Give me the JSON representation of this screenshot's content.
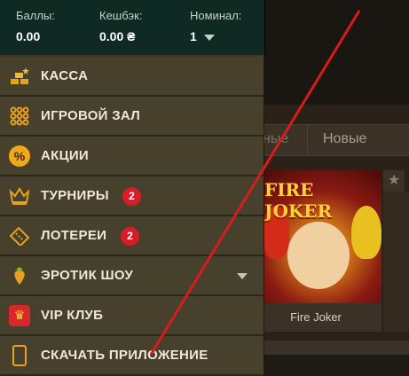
{
  "header": {
    "balance_label": "Баллы:",
    "balance_value": "0.00",
    "cashback_label": "Кешбэк:",
    "cashback_value": "0.00 ₴",
    "nominal_label": "Номинал:",
    "nominal_value": "1"
  },
  "menu": {
    "items": [
      {
        "label": "КАССА",
        "icon": "gold-bars-icon"
      },
      {
        "label": "ИГРОВОЙ ЗАЛ",
        "icon": "slot-grid-icon"
      },
      {
        "label": "АКЦИИ",
        "icon": "percent-icon"
      },
      {
        "label": "ТУРНИРЫ",
        "icon": "crown-icon",
        "badge": "2"
      },
      {
        "label": "ЛОТЕРЕИ",
        "icon": "ticket-icon",
        "badge": "2"
      },
      {
        "label": "ЭРОТИК ШОУ",
        "icon": "strawberry-icon"
      },
      {
        "label": "VIP КЛУБ",
        "icon": "vip-crown-icon"
      },
      {
        "label": "СКАЧАТЬ ПРИЛОЖЕНИЕ",
        "icon": "phone-icon"
      }
    ]
  },
  "tabs": {
    "tab1": "ные",
    "tab2": "Новые"
  },
  "game_card": {
    "art_title": "FIRE JOKER",
    "label": "Fire Joker"
  },
  "star_icon": "★",
  "colors": {
    "header_bg": "#0f2a22",
    "menu_bg": "#46402c",
    "badge_red": "#d81c2a",
    "annotation_line": "#d81c1c"
  }
}
